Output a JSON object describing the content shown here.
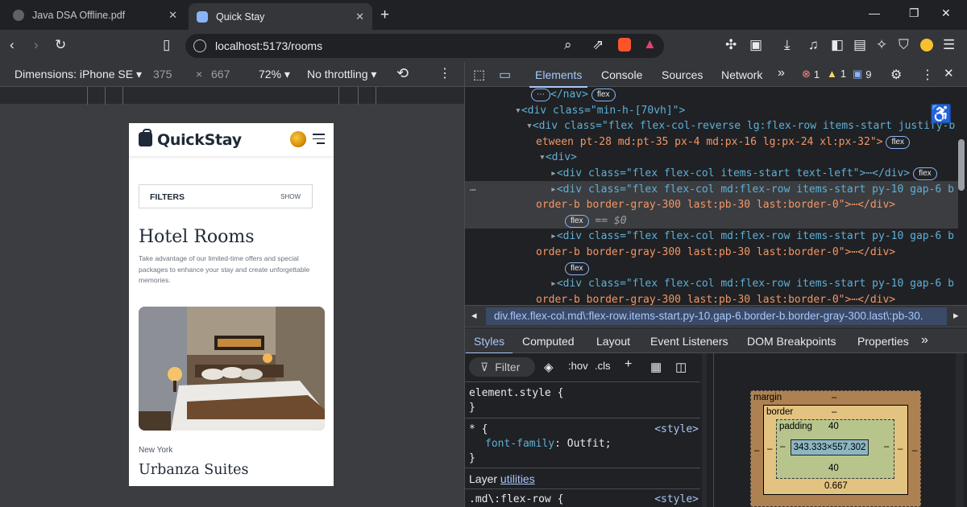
{
  "browser": {
    "tabs": [
      {
        "title": "Java DSA Offline.pdf",
        "active": false
      },
      {
        "title": "Quick Stay",
        "active": true
      }
    ],
    "new_tab": "+",
    "window_controls": {
      "minimize": "—",
      "restore": "❐",
      "close": "✕"
    },
    "url": "localhost:5173/rooms"
  },
  "device_toolbar": {
    "dimensions": "Dimensions: iPhone SE ▾",
    "width": "375",
    "x": "×",
    "height": "667",
    "zoom": "72% ▾",
    "throttling": "No throttling ▾"
  },
  "page": {
    "logo": "QuickStay",
    "filters_label": "FILTERS",
    "filters_toggle": "SHOW",
    "title": "Hotel Rooms",
    "description": "Take advantage of our limited-time offers and special packages to enhance your stay and create unforgettable memories.",
    "room_city": "New York",
    "room_name": "Urbanza Suites"
  },
  "devtools": {
    "tabs": [
      "Elements",
      "Console",
      "Sources",
      "Network"
    ],
    "more_tabs": "»",
    "errors": "1",
    "warnings": "1",
    "messages": "9",
    "dom": [
      {
        "text": "</nav>",
        "pill": "flex"
      },
      {
        "text": "<div class=\"min-h-[70vh]\">"
      },
      {
        "text": "<div class=\"flex flex-col-reverse lg:flex-row items-start justify-b"
      },
      {
        "text": "etween pt-28 md:pt-35 px-4 md:px-16 lg:px-24 xl:px-32\">",
        "pill": "flex"
      },
      {
        "text": "<div>"
      },
      {
        "text": "<div class=\"flex flex-col items-start text-left\">⋯</div>",
        "pill": "flex"
      },
      {
        "text": "<div class=\"flex flex-col md:flex-row items-start py-10 gap-6 b"
      },
      {
        "text": "order-b border-gray-300 last:pb-30 last:border-0\">⋯</div>"
      },
      {
        "text": "== $0",
        "pill": "flex"
      },
      {
        "text": "<div class=\"flex flex-col md:flex-row items-start py-10 gap-6 b"
      },
      {
        "text": "order-b border-gray-300 last:pb-30 last:border-0\">⋯</div>"
      },
      {
        "text": "",
        "pill": "flex"
      },
      {
        "text": "<div class=\"flex flex-col md:flex-row items-start py-10 gap-6 b"
      },
      {
        "text": "order-b border-gray-300 last:pb-30 last:border-0\">⋯</div>"
      }
    ],
    "breadcrumb": "div.flex.flex-col.md\\:flex-row.items-start.py-10.gap-6.border-b.border-gray-300.last\\:pb-30.",
    "sub_tabs": [
      "Styles",
      "Computed",
      "Layout",
      "Event Listeners",
      "DOM Breakpoints",
      "Properties"
    ],
    "filter_placeholder": "Filter",
    "hov": ":hov",
    "cls": ".cls",
    "styles": {
      "element_style": "element.style {",
      "close_brace": "}",
      "universal": "* {",
      "font_prop": "font-family",
      "font_val": "Outfit;",
      "style_src": "<style>",
      "layer_label": "Layer",
      "layer_link": "utilities",
      "md_rule": ".md\\:flex-row {"
    },
    "box_model": {
      "margin_label": "margin",
      "margin_value": "–",
      "border_label": "border",
      "border_value": "–",
      "padding_label": "padding",
      "padding_top": "40",
      "padding_bottom": "40",
      "content": "343.333×557.302",
      "side": "–",
      "bottom_value": "0.667"
    }
  }
}
